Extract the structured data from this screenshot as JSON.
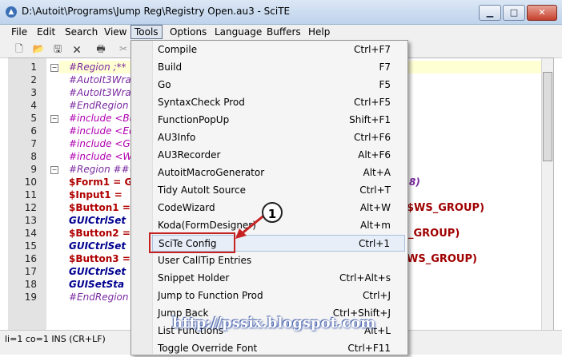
{
  "window": {
    "title": "D:\\Autoit\\Programs\\Jump Reg\\Registry Open.au3 - SciTE",
    "minimize": "▁",
    "maximize": "□",
    "close": "✕"
  },
  "menubar": [
    "File",
    "Edit",
    "Search",
    "View",
    "Tools",
    "Options",
    "Language",
    "Buffers",
    "Help"
  ],
  "toolbar_icons": [
    "new-file-icon",
    "open-folder-icon",
    "save-icon",
    "close-file-icon",
    "print-icon",
    "cut-icon"
  ],
  "editor": {
    "line_numbers": [
      "1",
      "2",
      "3",
      "4",
      "5",
      "6",
      "7",
      "8",
      "9",
      "10",
      "11",
      "12",
      "13",
      "14",
      "15",
      "16",
      "17",
      "18",
      "19"
    ],
    "lines": [
      {
        "text": "#Region ;**",
        "cls": "c-comment"
      },
      {
        "text": "#AutoIt3Wrap",
        "cls": "c-comment"
      },
      {
        "text": "#AutoIt3Wrap",
        "cls": "c-comment"
      },
      {
        "text": "#EndRegion",
        "cls": "c-comment"
      },
      {
        "text": "#include <Bu",
        "cls": "c-include"
      },
      {
        "text": "#include <Ed",
        "cls": "c-include"
      },
      {
        "text": "#include <GU",
        "cls": "c-include"
      },
      {
        "text": "#include <Wi",
        "cls": "c-include"
      },
      {
        "text": "#Region ###",
        "cls": "c-comment"
      },
      {
        "text": "$Form1 = G",
        "cls": "c-var"
      },
      {
        "text": "$Input1 = ",
        "cls": "c-var"
      },
      {
        "text": "$Button1 = ",
        "cls": "c-var"
      },
      {
        "text": "GUICtrlSet",
        "cls": "c-func"
      },
      {
        "text": "$Button2 = ",
        "cls": "c-var"
      },
      {
        "text": "GUICtrlSet",
        "cls": "c-func"
      },
      {
        "text": "$Button3 = ",
        "cls": "c-var"
      },
      {
        "text": "GUICtrlSet",
        "cls": "c-func"
      },
      {
        "text": "GUISetSta",
        "cls": "c-func"
      },
      {
        "text": "#EndRegion",
        "cls": "c-comment"
      }
    ],
    "tails": {
      "l10": "8)",
      "l12": "$WS_GROUP)",
      "l14": "_GROUP)",
      "l16": "WS_GROUP)"
    }
  },
  "status": "li=1 co=1 INS (CR+LF)",
  "tools_menu": [
    {
      "label": "Compile",
      "key": "Ctrl+F7"
    },
    {
      "label": "Build",
      "key": "F7"
    },
    {
      "label": "Go",
      "key": "F5"
    },
    {
      "label": "SyntaxCheck Prod",
      "key": "Ctrl+F5"
    },
    {
      "label": "FunctionPopUp",
      "key": "Shift+F1"
    },
    {
      "label": "AU3Info",
      "key": "Ctrl+F6"
    },
    {
      "label": "AU3Recorder",
      "key": "Alt+F6"
    },
    {
      "label": "AutoitMacroGenerator",
      "key": "Alt+A"
    },
    {
      "label": "Tidy AutoIt Source",
      "key": "Ctrl+T"
    },
    {
      "label": "CodeWizard",
      "key": "Alt+W"
    },
    {
      "label": "Koda(FormDesigner)",
      "key": "Alt+m"
    },
    {
      "label": "SciTe Config",
      "key": "Ctrl+1"
    },
    {
      "label": "User CallTip Entries",
      "key": ""
    },
    {
      "label": "Snippet Holder",
      "key": "Ctrl+Alt+s"
    },
    {
      "label": "Jump to Function Prod",
      "key": "Ctrl+J"
    },
    {
      "label": "Jump Back",
      "key": "Ctrl+Shift+J"
    },
    {
      "label": "List Functions",
      "key": "Alt+L"
    },
    {
      "label": "Toggle Override Font",
      "key": "Ctrl+F11"
    }
  ],
  "callout_number": "1",
  "watermark": "http://pssix.blogspot.com",
  "colors": {
    "highlight_border": "#c72222",
    "menu_hover": "#e8eef7"
  }
}
